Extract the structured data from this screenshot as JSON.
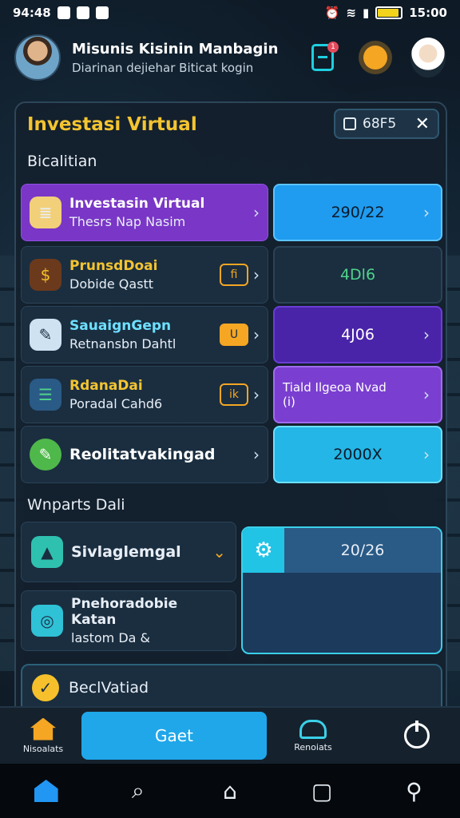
{
  "status_bar": {
    "time_left": "94:48",
    "time_right": "15:00"
  },
  "header": {
    "title": "Misunis Kisinin Manbagin",
    "subtitle": "Diarinan dejiehar Biticat kogin",
    "notification_count": "1"
  },
  "panel": {
    "title": "Investasi Virtual",
    "chip_label": "68F5",
    "chip_close": "✕",
    "section_label": "Bicalitian",
    "rows": [
      {
        "title": "Investasin Virtual",
        "subtitle": "Thesrs Nap Nasim",
        "tag": "",
        "value": "290/22",
        "value_chevron": "›"
      },
      {
        "title": "PrunsdDoai",
        "subtitle": "Dobide Qastt",
        "tag": "fi",
        "value": "4Dl6",
        "value_chevron": ""
      },
      {
        "title": "SauaignGepn",
        "subtitle": "Retnansbn Dahtl",
        "tag": "U",
        "value": "4J06",
        "value_chevron": "›"
      },
      {
        "title": "RdanaDai",
        "subtitle": "Poradal Cahd6",
        "tag": "ik",
        "value": "Tiald Ilgeoa Nvad (i)",
        "value_chevron": "›"
      },
      {
        "title": "Reolitatvakingad",
        "subtitle": "",
        "tag": "",
        "value": "2000X",
        "value_chevron": "›"
      }
    ],
    "section2_label": "Wnparts Dali",
    "lower_rows": [
      {
        "title": "Sivlaglemgal",
        "subtitle": ""
      },
      {
        "title": "Pnehoradobie Katan",
        "subtitle": "lastom Da &"
      }
    ],
    "preview_value": "20/26",
    "bottom_row": "BeclVatiad"
  },
  "toolbar": {
    "home_label": "Nisoalats",
    "gaet_label": "Gaet",
    "cloud_label": "Renoiats"
  },
  "colors": {
    "accent_yellow": "#f4c430",
    "accent_cyan": "#22c4e6",
    "accent_purple": "#7a36c7",
    "accent_blue": "#1fa7ea"
  }
}
